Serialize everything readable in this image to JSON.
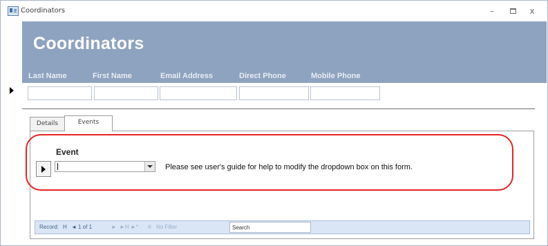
{
  "window": {
    "title": "Coordinators",
    "minimize": "–",
    "close": "x"
  },
  "form": {
    "title": "Coordinators",
    "columns": [
      "Last Name",
      "First Name",
      "Email Address",
      "Direct Phone",
      "Mobile Phone"
    ]
  },
  "tabs": [
    {
      "label": "Details",
      "active": false
    },
    {
      "label": "Events",
      "active": true
    }
  ],
  "subform": {
    "event_label": "Event",
    "event_value": "",
    "help_text": "Please see user's guide for help to modify the dropdown box on this form."
  },
  "navigation": {
    "record_label": "Record:",
    "first": "H",
    "prev": "◄",
    "position": "1 of 1",
    "next": "►",
    "last": "►H",
    "new": "►*",
    "filter": "No Filter",
    "search": "Search"
  },
  "colors": {
    "header": "#8ea3bf",
    "highlight": "#e52222",
    "navbar": "#dae6f5"
  }
}
